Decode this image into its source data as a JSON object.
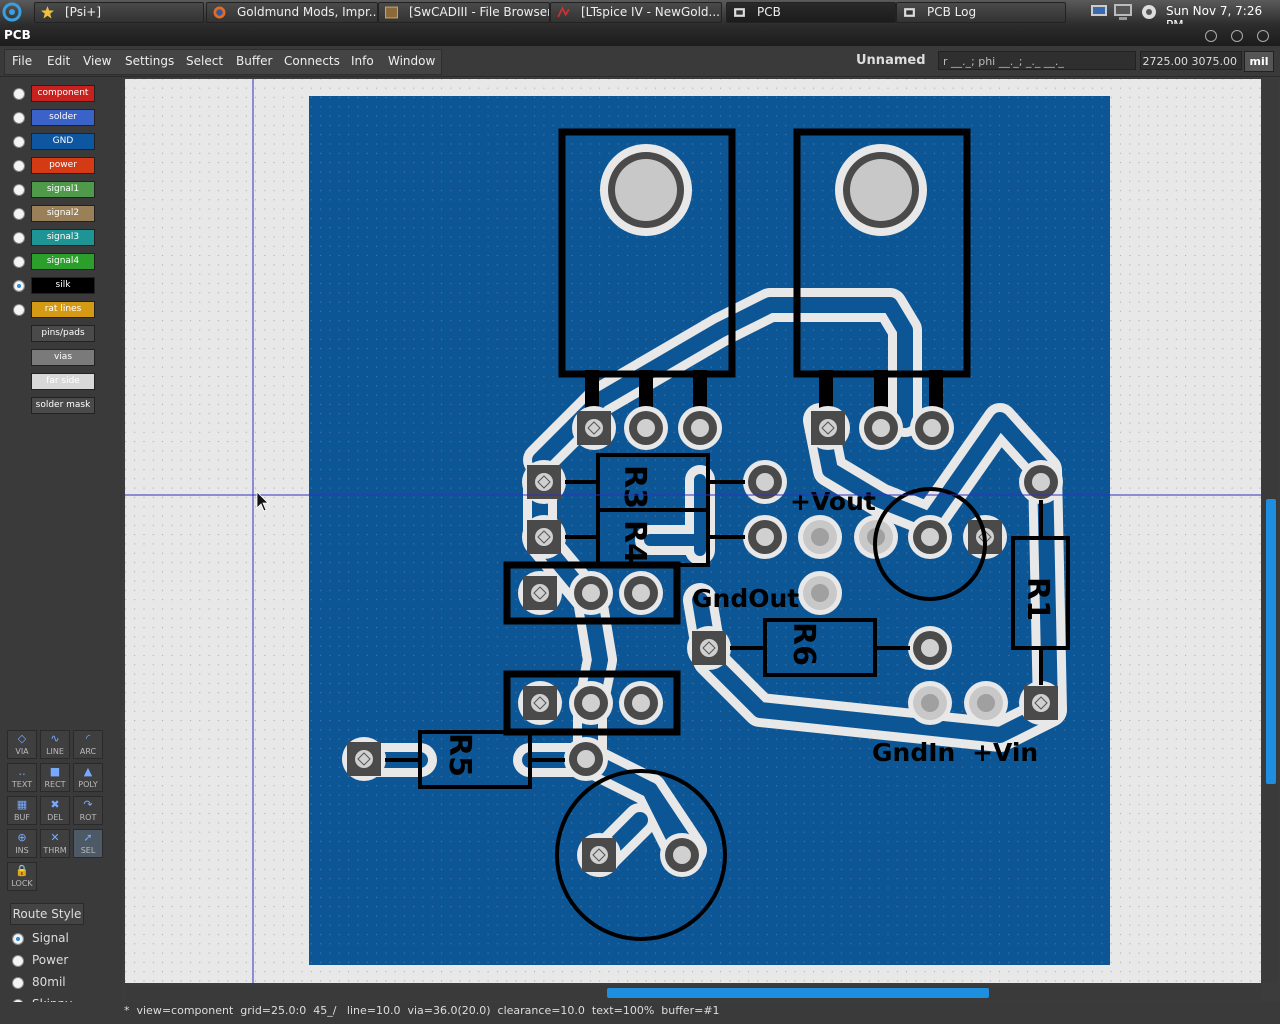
{
  "taskbar": {
    "tasks": [
      {
        "label": "[Psi+]"
      },
      {
        "label": "Goldmund Mods, Impr..."
      },
      {
        "label": "[SwCADIII - File Browser]"
      },
      {
        "label": "[LTspice IV - NewGold...."
      },
      {
        "label": "PCB"
      },
      {
        "label": "PCB Log"
      }
    ],
    "clock": "Sun Nov  7,  7:26 PM"
  },
  "window": {
    "title": "PCB"
  },
  "menu": {
    "items": [
      "File",
      "Edit",
      "View",
      "Settings",
      "Select",
      "Buffer",
      "Connects",
      "Info",
      "Window"
    ],
    "filename": "Unnamed",
    "coord_text": "r __._; phi __._; _._ __._",
    "position": "2725.00 3075.00",
    "unit": "mil"
  },
  "layers": [
    {
      "label": "component",
      "color": "#c8201c",
      "selected": false
    },
    {
      "label": "solder",
      "color": "#3a62c8",
      "selected": false
    },
    {
      "label": "GND",
      "color": "#0e56a0",
      "selected": false
    },
    {
      "label": "power",
      "color": "#d43a14",
      "selected": false
    },
    {
      "label": "signal1",
      "color": "#4f9a4a",
      "selected": false
    },
    {
      "label": "signal2",
      "color": "#9a8058",
      "selected": false
    },
    {
      "label": "signal3",
      "color": "#1f9494",
      "selected": false
    },
    {
      "label": "signal4",
      "color": "#2c9e2c",
      "selected": false
    },
    {
      "label": "silk",
      "color": "#000000",
      "selected": true
    },
    {
      "label": "rat lines",
      "color": "#d49a14",
      "selected": false
    }
  ],
  "extra_layers": [
    {
      "label": "pins/pads",
      "color": "#4a4a4a"
    },
    {
      "label": "vias",
      "color": "#7a7a7a"
    },
    {
      "label": "far side",
      "color": "#d8d8d8"
    },
    {
      "label": "solder mask",
      "color": "#4a4a4a"
    }
  ],
  "tools": [
    {
      "name": "VIA",
      "icon": "via-icon"
    },
    {
      "name": "LINE",
      "icon": "line-icon"
    },
    {
      "name": "ARC",
      "icon": "arc-icon"
    },
    {
      "name": "TEXT",
      "icon": "text-icon"
    },
    {
      "name": "RECT",
      "icon": "rect-icon"
    },
    {
      "name": "POLY",
      "icon": "poly-icon"
    },
    {
      "name": "BUF",
      "icon": "buffer-icon"
    },
    {
      "name": "DEL",
      "icon": "delete-icon"
    },
    {
      "name": "ROT",
      "icon": "rotate-icon"
    },
    {
      "name": "INS",
      "icon": "insert-icon"
    },
    {
      "name": "THRM",
      "icon": "thermal-icon"
    },
    {
      "name": "SEL",
      "icon": "select-icon"
    },
    {
      "name": "LOCK",
      "icon": "lock-icon"
    }
  ],
  "route_style": {
    "label": "Route Style",
    "options": [
      {
        "label": "Signal",
        "selected": true
      },
      {
        "label": "Power",
        "selected": false
      },
      {
        "label": "80mil",
        "selected": false
      },
      {
        "label": "Skinny",
        "selected": false
      }
    ]
  },
  "board": {
    "labels": [
      "R3",
      "R4",
      "+Vout",
      "GndOut",
      "R6",
      "R1",
      "R5",
      "GndIn",
      "+Vin"
    ]
  },
  "status": {
    "text": "*  view=component  grid=25.0:0  45_/   line=10.0  via=36.0(20.0)  clearance=10.0  text=100%  buffer=#1"
  },
  "colors": {
    "board": "#0d5696",
    "canvas_bg": "#e8e8e8",
    "accent": "#1e8fe0"
  }
}
